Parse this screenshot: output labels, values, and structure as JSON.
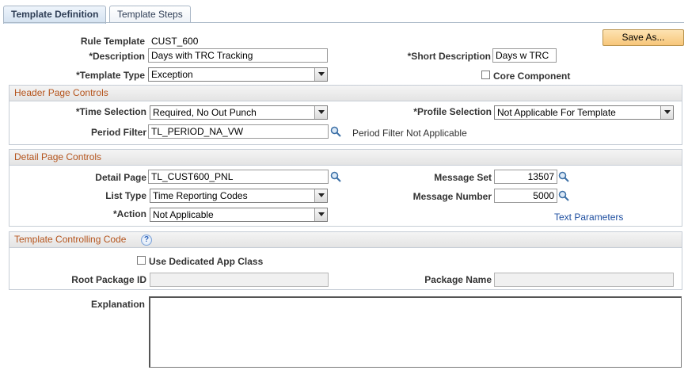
{
  "tabs": [
    {
      "label": "Template Definition",
      "active": true
    },
    {
      "label": "Template Steps",
      "active": false
    }
  ],
  "buttons": {
    "save_as": "Save As..."
  },
  "rule_template": {
    "label": "Rule Template",
    "value": "CUST_600"
  },
  "description": {
    "label": "*Description",
    "value": "Days with TRC Tracking"
  },
  "short_description": {
    "label": "*Short Description",
    "value": "Days w TRC"
  },
  "template_type": {
    "label": "*Template Type",
    "value": "Exception"
  },
  "core_component": {
    "label": "Core Component",
    "checked": false
  },
  "header_section": {
    "title": "Header Page Controls",
    "time_selection": {
      "label": "*Time Selection",
      "value": "Required, No Out Punch"
    },
    "profile_selection": {
      "label": "*Profile Selection",
      "value": "Not Applicable For Template"
    },
    "period_filter": {
      "label": "Period Filter",
      "value": "TL_PERIOD_NA_VW",
      "description": "Period Filter Not Applicable"
    }
  },
  "detail_section": {
    "title": "Detail Page Controls",
    "detail_page": {
      "label": "Detail Page",
      "value": "TL_CUST600_PNL"
    },
    "message_set": {
      "label": "Message Set",
      "value": "13507"
    },
    "list_type": {
      "label": "List Type",
      "value": "Time Reporting Codes"
    },
    "message_number": {
      "label": "Message Number",
      "value": "5000"
    },
    "action": {
      "label": "*Action",
      "value": "Not Applicable"
    },
    "text_parameters": "Text Parameters"
  },
  "controlling_section": {
    "title": "Template Controlling Code",
    "help_icon": "?",
    "use_dedicated_app_class": {
      "label": "Use Dedicated App Class",
      "checked": false
    },
    "root_package_id": {
      "label": "Root Package ID",
      "value": ""
    },
    "package_name": {
      "label": "Package Name",
      "value": ""
    }
  },
  "explanation": {
    "label": "Explanation",
    "value": ""
  },
  "icons": {
    "lookup": "magnifier-lookup-icon",
    "dropdown": "chevron-down-icon",
    "help": "question-mark-icon"
  },
  "colors": {
    "section_title": "#b5541c",
    "link": "#1f4fa0",
    "button": "#f7c67a",
    "tab_text": "#2e3d55"
  }
}
